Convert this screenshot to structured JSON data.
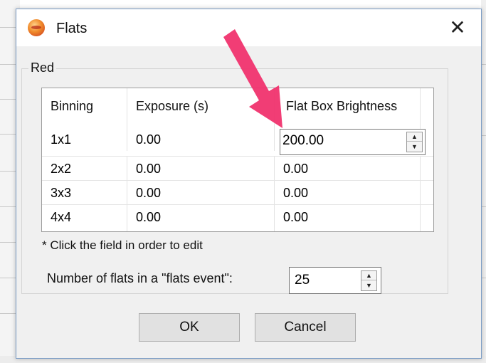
{
  "dialog": {
    "title": "Flats",
    "close_glyph": "✕",
    "app_icon": "app-logo-icon"
  },
  "group": {
    "label": "Red"
  },
  "table": {
    "headers": [
      "Binning",
      "Exposure (s)",
      "Flat Box Brightness"
    ],
    "rows": [
      [
        "1x1",
        "0.00",
        "200.00"
      ],
      [
        "2x2",
        "0.00",
        "0.00"
      ],
      [
        "3x3",
        "0.00",
        "0.00"
      ],
      [
        "4x4",
        "0.00",
        "0.00"
      ]
    ]
  },
  "hint": "* Click the field in order to edit",
  "flats_event": {
    "label": "Number of flats in a \"flats event\":",
    "value": "25"
  },
  "buttons": {
    "ok": "OK",
    "cancel": "Cancel"
  },
  "annotation": {
    "arrow_color": "#f0336e"
  }
}
